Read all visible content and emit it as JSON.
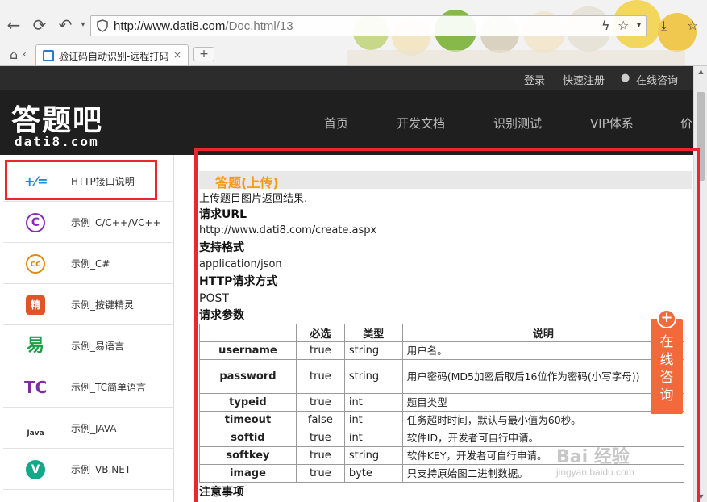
{
  "browser": {
    "url_domain": "http://www.dati8.com",
    "url_path": "/Doc.html/13",
    "tab_title": "验证码自动识别-远程打码",
    "new_tab_label": "+",
    "tab_close_label": "×"
  },
  "site": {
    "top_links": [
      "登录",
      "快速注册",
      "在线咨询"
    ],
    "logo_cn": "答题吧",
    "logo_en": "dati8.com",
    "nav": [
      "首页",
      "开发文档",
      "识别测试",
      "VIP体系",
      "价"
    ]
  },
  "sidebar": {
    "items": [
      {
        "label": "HTTP接口说明",
        "icon": "plus-equals-icon",
        "glyph": "+⁄=",
        "color": "#1b8fd1"
      },
      {
        "label": "示例_C/C++/VC++",
        "icon": "c-circle-icon",
        "glyph": "C",
        "color": "#8a2bb8"
      },
      {
        "label": "示例_C#",
        "icon": "cc-circle-icon",
        "glyph": "cc",
        "color": "#e08a12"
      },
      {
        "label": "示例_按键精灵",
        "icon": "bee-icon",
        "glyph": "精",
        "color": "#e0542b"
      },
      {
        "label": "示例_易语言",
        "icon": "yi-icon",
        "glyph": "易",
        "color": "#1aa04b"
      },
      {
        "label": "示例_TC简单语言",
        "icon": "tc-icon",
        "glyph": "TC",
        "color": "#7b2fa0"
      },
      {
        "label": "示例_JAVA",
        "icon": "java-icon",
        "glyph": "Java",
        "color": "#333333"
      },
      {
        "label": "示例_VB.NET",
        "icon": "v-circle-icon",
        "glyph": "V",
        "color": "#12a88a"
      }
    ]
  },
  "content": {
    "section_title": "答题(上传)",
    "intro": "上传题目图片返回结果.",
    "url_heading": "请求URL",
    "url_value": "http://www.dati8.com/create.aspx",
    "format_heading": "支持格式",
    "format_value": "application/json",
    "method_heading": "HTTP请求方式",
    "method_value": "POST",
    "params_heading": "请求参数",
    "notes_heading": "注意事项",
    "table": {
      "headers": [
        "",
        "必选",
        "类型",
        "说明"
      ],
      "rows": [
        {
          "name": "username",
          "required": "true",
          "type": "string",
          "desc": "用户名。"
        },
        {
          "name": "password",
          "required": "true",
          "type": "string",
          "desc": "用户密码(MD5加密后取后16位作为密码(小写字母))"
        },
        {
          "name": "typeid",
          "required": "true",
          "type": "int",
          "desc": "题目类型"
        },
        {
          "name": "timeout",
          "required": "false",
          "type": "int",
          "desc": "任务超时时间，默认与最小值为60秒。"
        },
        {
          "name": "softid",
          "required": "true",
          "type": "int",
          "desc": "软件ID，开发者可自行申请。"
        },
        {
          "name": "softkey",
          "required": "true",
          "type": "string",
          "desc": "软件KEY，开发者可自行申请。"
        },
        {
          "name": "image",
          "required": "true",
          "type": "byte",
          "desc": "只支持原始图二进制数据。"
        }
      ]
    }
  },
  "consult": {
    "plus": "+",
    "label": "在线咨询"
  },
  "watermark": {
    "line1": "Bai 经验",
    "line2": "jingyan.baidu.com"
  },
  "colors": {
    "accent_orange": "#f49b17",
    "highlight_red": "#e8272f",
    "consult_orange": "#f26a3c",
    "header_dark": "#1f1f1f"
  }
}
